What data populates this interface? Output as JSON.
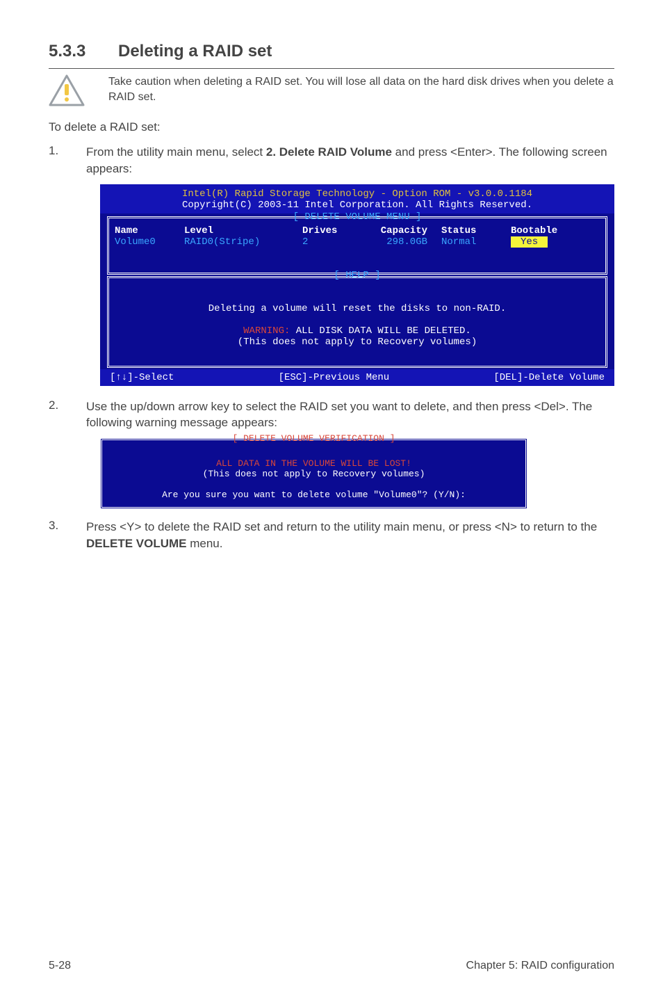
{
  "heading": {
    "number": "5.3.3",
    "title": "Deleting a RAID set"
  },
  "caution": "Take caution when deleting a RAID set. You will lose all data on the hard disk drives when you delete a RAID set.",
  "intro": "To delete a RAID set:",
  "steps": {
    "s1": {
      "num": "1.",
      "before": "From the utility main menu, select ",
      "bold": "2. Delete RAID Volume",
      "after": " and press <Enter>. The following screen appears:"
    },
    "s2": {
      "num": "2.",
      "text": "Use the up/down arrow key to select the RAID set you want to delete, and then press <Del>. The following warning message appears:"
    },
    "s3": {
      "num": "3.",
      "before": "Press <Y> to delete the RAID set and return to the utility main menu, or press <N> to return to the ",
      "bold": "DELETE VOLUME",
      "after": " menu."
    }
  },
  "bios": {
    "title1": "Intel(R) Rapid Storage Technology - Option ROM - v3.0.0.1184",
    "title2": "Copyright(C) 2003-11 Intel Corporation.  All Rights Reserved.",
    "delete_menu_label": "[ DELETE VOLUME MENU ]",
    "headers": {
      "name": "Name",
      "level": "Level",
      "drives": "Drives",
      "capacity": "Capacity",
      "status": "Status",
      "bootable": "Bootable"
    },
    "row": {
      "name": "Volume0",
      "level": "RAID0(Stripe)",
      "drives": "2",
      "capacity": "298.0GB",
      "status": "Normal",
      "bootable": "Yes"
    },
    "help_label": "[ HELP ]",
    "help1": "Deleting a volume will reset the disks to non-RAID.",
    "warn_label": "WARNING:",
    "help2": " ALL DISK DATA WILL BE DELETED.",
    "help3": "(This does not apply to Recovery volumes)",
    "bottom_left": "[↑↓]-Select",
    "bottom_mid": "[ESC]-Previous Menu",
    "bottom_right": "[DEL]-Delete Volume"
  },
  "confirm": {
    "title": "[ DELETE VOLUME VERIFICATION ]",
    "lost": "ALL DATA IN THE VOLUME WILL BE LOST!",
    "recovery": "(This does not apply to Recovery volumes)",
    "question": "Are you sure you want to delete volume \"Volume0\"? (Y/N):"
  },
  "footer": {
    "left": "5-28",
    "right": "Chapter 5: RAID configuration"
  }
}
